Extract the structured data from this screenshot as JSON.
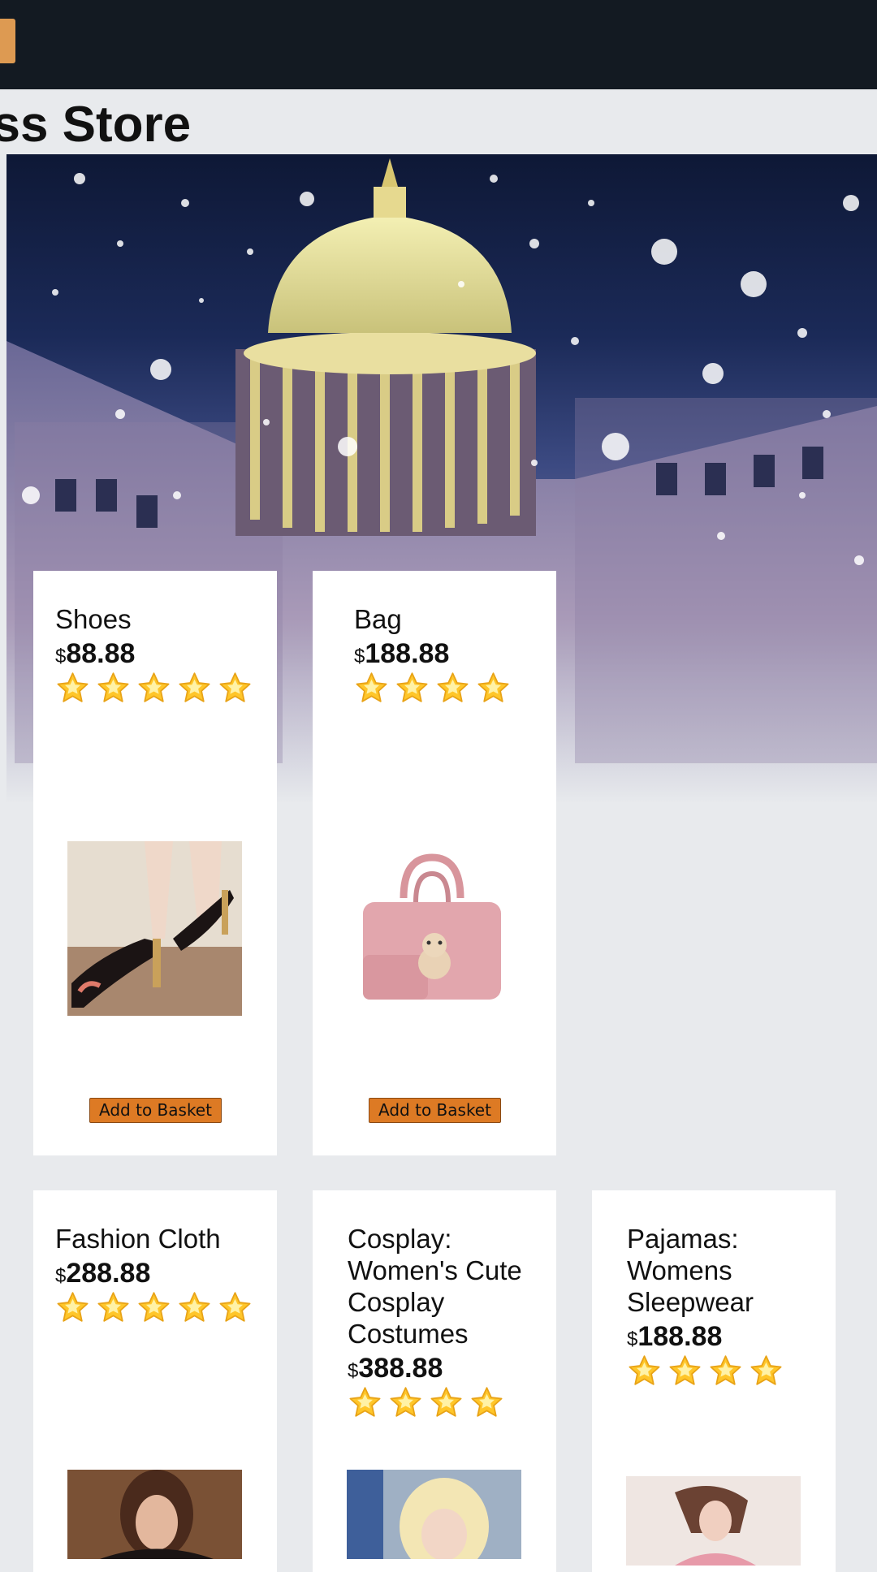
{
  "header": {
    "store_title": "ess Store"
  },
  "products": [
    {
      "title": "Shoes",
      "currency": "$",
      "price": "88.88",
      "rating": 5,
      "button": "Add to Basket",
      "image": "black-heeled-sandal"
    },
    {
      "title": "Bag",
      "currency": "$",
      "price": "188.88",
      "rating": 4,
      "button": "Add to Basket",
      "image": "pink-handbag-with-teddy"
    },
    {
      "title": "Fashion Cloth",
      "currency": "$",
      "price": "288.88",
      "rating": 5,
      "image": "woman-in-black-jacket"
    },
    {
      "title": "Cosplay: Women's Cute Cosplay Costumes",
      "currency": "$",
      "price": "388.88",
      "rating": 4,
      "image": "blonde-cosplay-girl"
    },
    {
      "title": "Pajamas: Womens Sleepwear",
      "currency": "$",
      "price": "188.88",
      "rating": 4,
      "image": "woman-in-pink-sleepwear"
    }
  ],
  "colors": {
    "topbar": "#131a22",
    "accent": "#dd9a52",
    "button": "#dd7a24",
    "page": "#e8eaed",
    "star": "#ffc629"
  }
}
